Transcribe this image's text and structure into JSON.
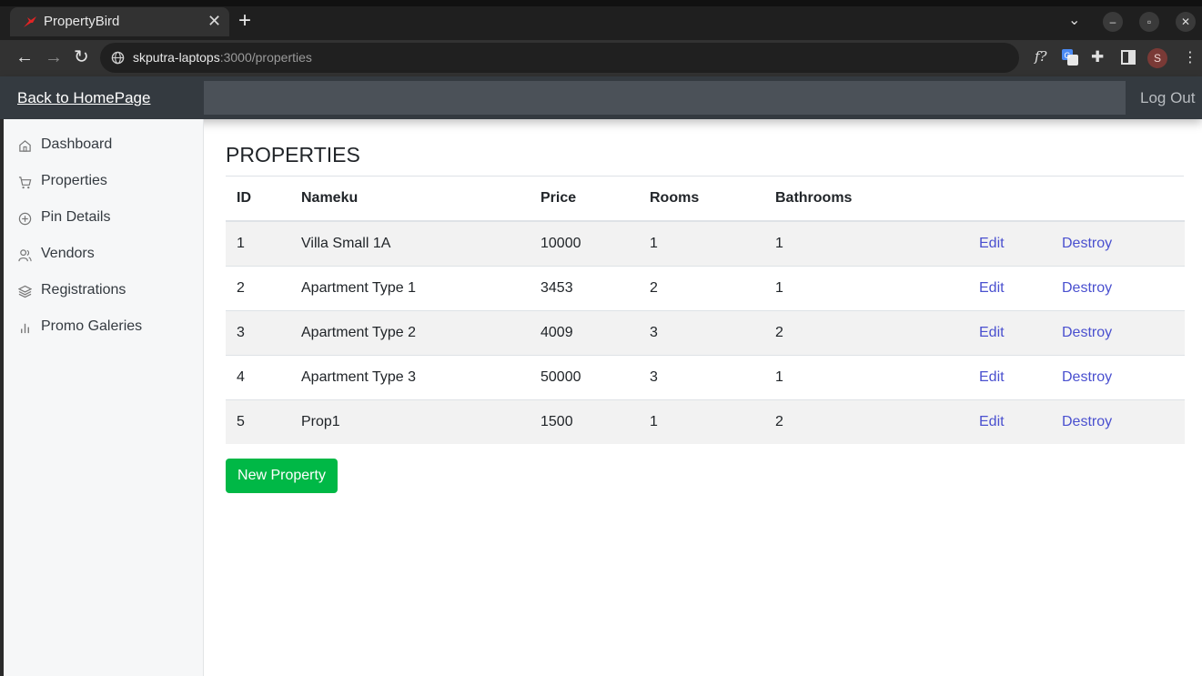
{
  "browser": {
    "tab_title": "PropertyBird",
    "tab_close": "✕",
    "new_tab": "+",
    "url_host": "skputra-laptops",
    "url_path": ":3000/properties",
    "profile_initial": "S",
    "ext_formula": "f?",
    "accent": "#00b846"
  },
  "header": {
    "home_link": "Back to HomePage",
    "logout": "Log Out"
  },
  "sidebar": {
    "items": [
      {
        "label": "Dashboard",
        "icon": "home-icon"
      },
      {
        "label": "Properties",
        "icon": "cart-icon"
      },
      {
        "label": "Pin Details",
        "icon": "plus-circle-icon"
      },
      {
        "label": "Vendors",
        "icon": "users-icon"
      },
      {
        "label": "Registrations",
        "icon": "layers-icon"
      },
      {
        "label": "Promo Galeries",
        "icon": "bar-chart-icon"
      }
    ]
  },
  "main": {
    "title": "PROPERTIES",
    "columns": [
      "ID",
      "Nameku",
      "Price",
      "Rooms",
      "Bathrooms"
    ],
    "rows": [
      {
        "id": "1",
        "name": "Villa Small 1A",
        "price": "10000",
        "rooms": "1",
        "bathrooms": "1",
        "edit": "Edit",
        "destroy": "Destroy"
      },
      {
        "id": "2",
        "name": "Apartment Type 1",
        "price": "3453",
        "rooms": "2",
        "bathrooms": "1",
        "edit": "Edit",
        "destroy": "Destroy"
      },
      {
        "id": "3",
        "name": "Apartment Type 2",
        "price": "4009",
        "rooms": "3",
        "bathrooms": "2",
        "edit": "Edit",
        "destroy": "Destroy"
      },
      {
        "id": "4",
        "name": "Apartment Type 3",
        "price": "50000",
        "rooms": "3",
        "bathrooms": "1",
        "edit": "Edit",
        "destroy": "Destroy"
      },
      {
        "id": "5",
        "name": "Prop1",
        "price": "1500",
        "rooms": "1",
        "bathrooms": "2",
        "edit": "Edit",
        "destroy": "Destroy"
      }
    ],
    "new_button": "New Property"
  }
}
